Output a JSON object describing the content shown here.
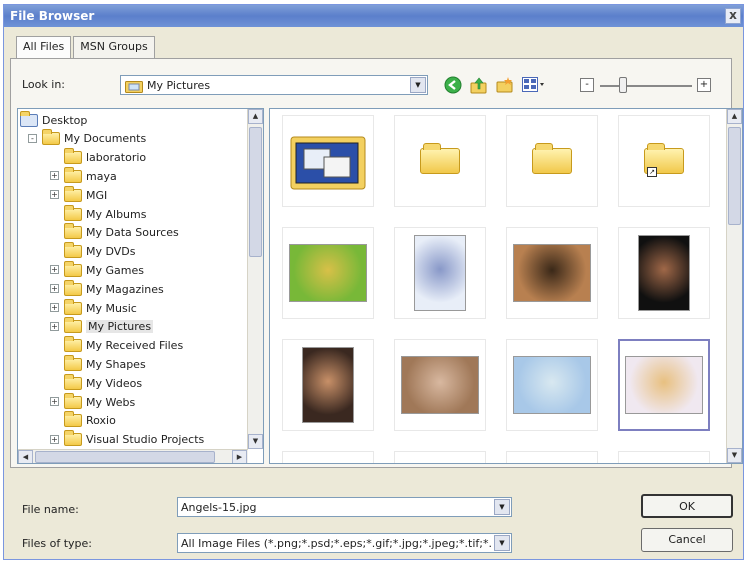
{
  "window": {
    "title": "File Browser",
    "close_glyph": "x"
  },
  "tabs": [
    {
      "label": "All Files",
      "active": true
    },
    {
      "label": "MSN Groups",
      "active": false
    }
  ],
  "lookin": {
    "label": "Look in:",
    "value": "My Pictures"
  },
  "toolbar": {
    "icons": [
      "back-icon",
      "up-folder-icon",
      "new-folder-icon",
      "view-menu-icon"
    ],
    "zoom_minus": "-",
    "zoom_plus": "+"
  },
  "tree": {
    "items": [
      {
        "label": "Desktop",
        "level": 0,
        "expander": ""
      },
      {
        "label": "My Documents",
        "level": 1,
        "expander": "-"
      },
      {
        "label": "laboratorio",
        "level": 2,
        "expander": ""
      },
      {
        "label": "maya",
        "level": 2,
        "expander": "+"
      },
      {
        "label": "MGI",
        "level": 2,
        "expander": "+"
      },
      {
        "label": "My Albums",
        "level": 2,
        "expander": ""
      },
      {
        "label": "My Data Sources",
        "level": 2,
        "expander": ""
      },
      {
        "label": "My DVDs",
        "level": 2,
        "expander": ""
      },
      {
        "label": "My Games",
        "level": 2,
        "expander": "+"
      },
      {
        "label": "My Magazines",
        "level": 2,
        "expander": "+"
      },
      {
        "label": "My Music",
        "level": 2,
        "expander": "+"
      },
      {
        "label": "My Pictures",
        "level": 2,
        "expander": "+"
      },
      {
        "label": "My Received Files",
        "level": 2,
        "expander": ""
      },
      {
        "label": "My Shapes",
        "level": 2,
        "expander": ""
      },
      {
        "label": "My Videos",
        "level": 2,
        "expander": ""
      },
      {
        "label": "My Webs",
        "level": 2,
        "expander": "+"
      },
      {
        "label": "Roxio",
        "level": 2,
        "expander": ""
      },
      {
        "label": "Visual Studio Projects",
        "level": 2,
        "expander": "+"
      }
    ]
  },
  "grid": {
    "items": [
      {
        "kind": "special-folder"
      },
      {
        "kind": "folder"
      },
      {
        "kind": "folder"
      },
      {
        "kind": "folder-shortcut"
      },
      {
        "kind": "image",
        "palette": [
          "#78b838",
          "#d8c048"
        ]
      },
      {
        "kind": "image",
        "palette": [
          "#e8eef8",
          "#8898c8"
        ]
      },
      {
        "kind": "image",
        "palette": [
          "#b88050",
          "#3a2818"
        ]
      },
      {
        "kind": "image",
        "palette": [
          "#101010",
          "#a06848"
        ]
      },
      {
        "kind": "image",
        "palette": [
          "#3a2820",
          "#c89068"
        ]
      },
      {
        "kind": "image",
        "palette": [
          "#a07858",
          "#d8b8a0"
        ]
      },
      {
        "kind": "image",
        "palette": [
          "#a8c8e8",
          "#d8e8f0"
        ]
      },
      {
        "kind": "image",
        "palette": [
          "#f0e8f0",
          "#e8c080"
        ],
        "selected": true
      },
      {
        "kind": "image",
        "palette": [
          "#f8f0e8",
          "#202020"
        ]
      },
      {
        "kind": "image",
        "palette": [
          "#f8f4ec",
          "#604028"
        ]
      },
      {
        "kind": "image",
        "palette": [
          "#f8f8f0",
          "#88a840"
        ]
      },
      {
        "kind": "image",
        "palette": [
          "#f4f8f0",
          "#98c078"
        ]
      }
    ]
  },
  "file_name": {
    "label": "File name:",
    "value": "Angels-15.jpg"
  },
  "file_type": {
    "label": "Files of type:",
    "value": "All Image Files (*.png;*.psd;*.eps;*.gif;*.jpg;*.jpeg;*.tif;*.bmp)"
  },
  "buttons": {
    "ok": "OK",
    "cancel": "Cancel"
  },
  "colors": {
    "title_bar": "#5b7fcb",
    "selection_border": "#7d7fc0",
    "dialog_bg": "#ece9d8"
  }
}
